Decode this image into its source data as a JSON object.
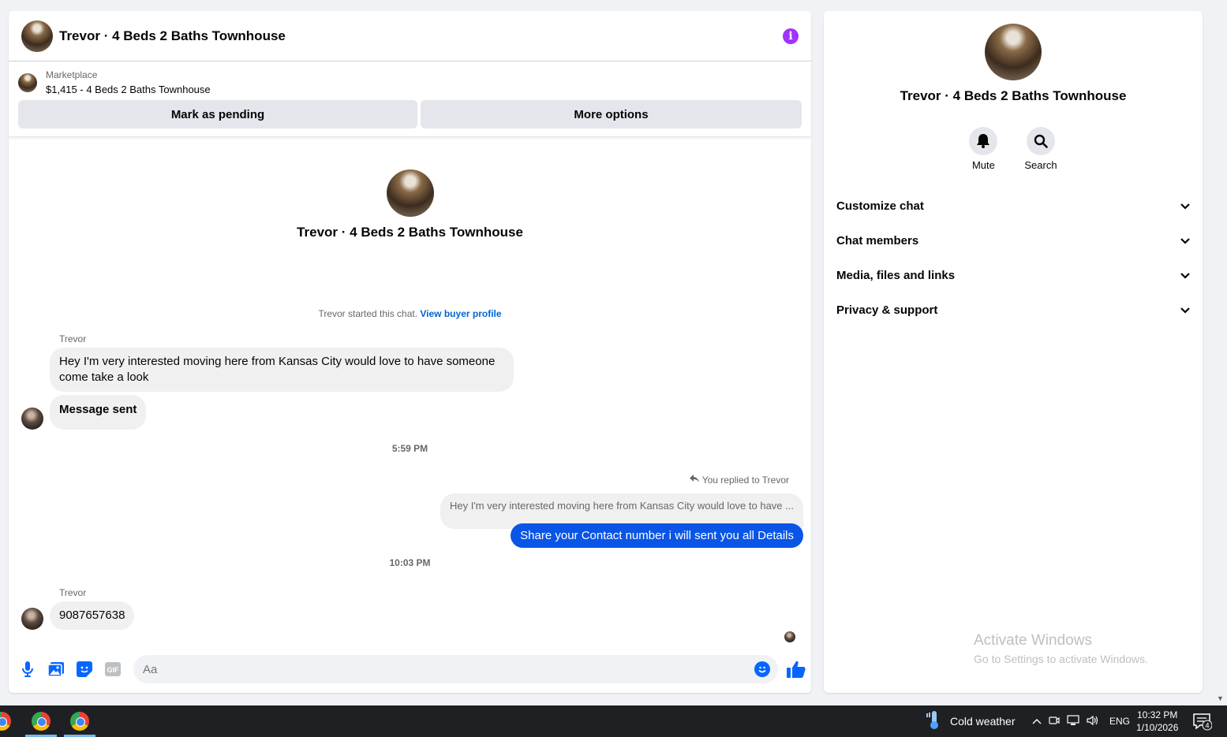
{
  "chat": {
    "title": "Trevor · 4 Beds 2 Baths Townhouse",
    "listing": {
      "source": "Marketplace",
      "description": "$1,415 - 4 Beds 2 Baths Townhouse",
      "mark_pending_label": "Mark as pending",
      "more_options_label": "More options"
    },
    "intro_title": "Trevor · 4 Beds 2 Baths Townhouse",
    "started_text": "Trevor started this chat.",
    "view_buyer_profile": "View buyer profile",
    "messages": [
      {
        "sender": "Trevor",
        "text": "Hey I'm very interested moving here from Kansas City would love to have someone come take a look"
      },
      {
        "text": "Message sent"
      }
    ],
    "time_1": "5:59 PM",
    "reply": {
      "label": "You replied to Trevor",
      "quoted": "Hey I'm very interested moving here from Kansas City would love to have ...",
      "sent": "Share your Contact number i will sent you all Details"
    },
    "time_2": "10:03 PM",
    "last_message": {
      "sender": "Trevor",
      "text": "9087657638"
    },
    "composer_placeholder": "Aa"
  },
  "details": {
    "title": "Trevor · 4 Beds 2 Baths Townhouse",
    "mute_label": "Mute",
    "search_label": "Search",
    "sections": [
      "Customize chat",
      "Chat members",
      "Media, files and links",
      "Privacy & support"
    ],
    "watermark_line1": "Activate Windows",
    "watermark_line2": "Go to Settings to activate Windows."
  },
  "taskbar": {
    "weather": "Cold weather",
    "language": "ENG",
    "time": "10:32 PM",
    "date": "1/10/2026",
    "notification_count": "4"
  },
  "colors": {
    "accent_blue": "#0866ff",
    "sent_bubble": "#0a55e6",
    "info_purple": "#a033ff"
  }
}
